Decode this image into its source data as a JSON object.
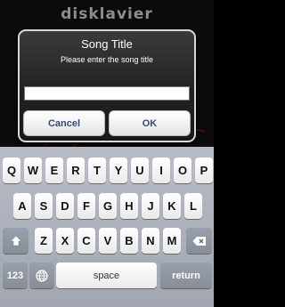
{
  "app": {
    "brand": "disklavier"
  },
  "dialog": {
    "title": "Song Title",
    "message": "Please enter the song title",
    "input_value": "",
    "cancel_label": "Cancel",
    "ok_label": "OK"
  },
  "keyboard": {
    "row1": [
      "Q",
      "W",
      "E",
      "R",
      "T",
      "Y",
      "U",
      "I",
      "O",
      "P"
    ],
    "row2": [
      "A",
      "S",
      "D",
      "F",
      "G",
      "H",
      "J",
      "K",
      "L"
    ],
    "row3": [
      "Z",
      "X",
      "C",
      "V",
      "B",
      "N",
      "M"
    ],
    "numbers_label": "123",
    "space_label": "space",
    "return_label": "return",
    "icons": {
      "shift": "shift-icon",
      "globe": "globe-icon",
      "delete": "delete-icon"
    }
  }
}
